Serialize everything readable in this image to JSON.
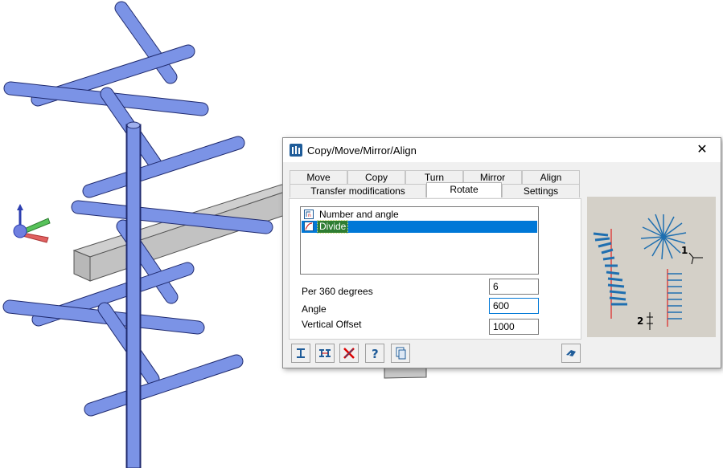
{
  "dialog": {
    "title": "Copy/Move/Mirror/Align",
    "close_symbol": "✕",
    "tabs_row1": [
      "Move",
      "Copy",
      "Turn",
      "Mirror",
      "Align"
    ],
    "tabs_row2": [
      "Transfer modifications",
      "Rotate",
      "Settings"
    ],
    "active_tab": "Rotate",
    "list_items": [
      {
        "label": "Number and angle",
        "selected": false
      },
      {
        "label": "Divide",
        "selected": true
      }
    ],
    "fields": {
      "per360_label": "Per 360 degrees",
      "per360_value": "6",
      "angle_label": "Angle",
      "angle_value": "600",
      "vertical_offset_label": "Vertical Offset",
      "vertical_offset_value": "1000"
    },
    "preview_labels": {
      "one": "1",
      "two": "2"
    },
    "toolbar_icons": [
      "profile-i-icon",
      "dimension-icon",
      "delete-x-icon",
      "help-icon",
      "copy-doc-icon",
      "apply-icon"
    ]
  },
  "colors": {
    "accent": "#0078d7",
    "bar": "#7b93e6",
    "bar_edge": "#1f2a6e",
    "selected_text_bg": "#2e7d32"
  }
}
